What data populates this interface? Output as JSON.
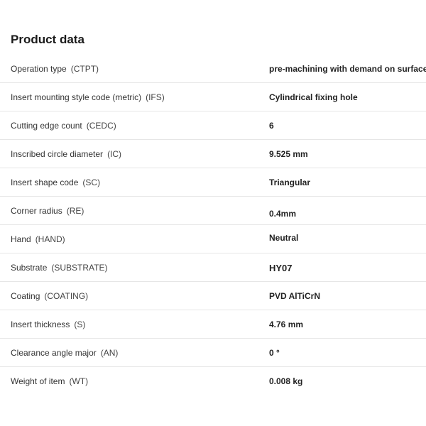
{
  "section": {
    "title": "Product data"
  },
  "rows": [
    {
      "label": "Operation type",
      "code": "(CTPT)",
      "value": "pre-machining with demand on surface"
    },
    {
      "label": "Insert mounting style code (metric)",
      "code": "(IFS)",
      "value": "Cylindrical fixing hole"
    },
    {
      "label": "Cutting edge count",
      "code": "(CEDC)",
      "value": "6"
    },
    {
      "label": "Inscribed circle diameter",
      "code": "(IC)",
      "value": "9.525 mm"
    },
    {
      "label": "Insert shape code",
      "code": "(SC)",
      "value": "Triangular"
    },
    {
      "label": "Corner radius",
      "code": "(RE)",
      "value": "0.4mm"
    },
    {
      "label": "Hand",
      "code": "(HAND)",
      "value": "Neutral"
    },
    {
      "label": "Substrate",
      "code": "(SUBSTRATE)",
      "value": "HY07"
    },
    {
      "label": "Coating",
      "code": "(COATING)",
      "value": "PVD AlTiCrN"
    },
    {
      "label": "Insert thickness",
      "code": "(S)",
      "value": "4.76 mm"
    },
    {
      "label": "Clearance angle major",
      "code": "(AN)",
      "value": "0 °"
    },
    {
      "label": "Weight of item",
      "code": "(WT)",
      "value": "0.008 kg"
    }
  ]
}
